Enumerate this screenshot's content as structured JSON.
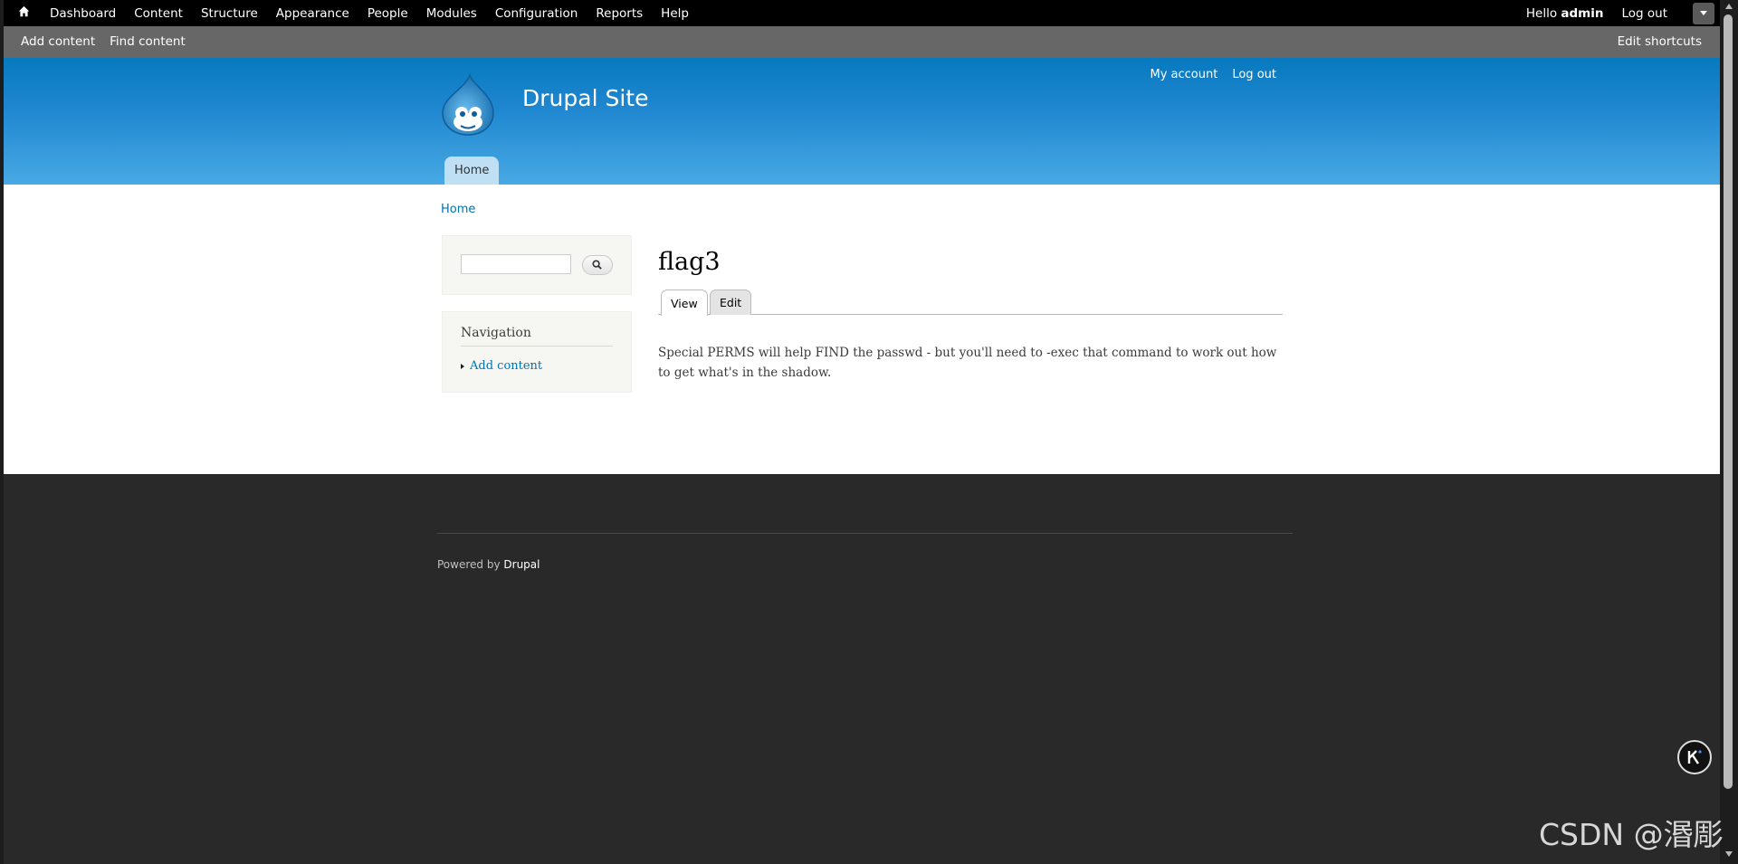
{
  "toolbar": {
    "home_icon": "home-icon",
    "menu": [
      "Dashboard",
      "Content",
      "Structure",
      "Appearance",
      "People",
      "Modules",
      "Configuration",
      "Reports",
      "Help"
    ],
    "hello_prefix": "Hello",
    "username": "admin",
    "logout": "Log out",
    "toggle_icon": "chevron-down-icon"
  },
  "shortcuts": {
    "items": [
      "Add content",
      "Find content"
    ],
    "edit": "Edit shortcuts"
  },
  "header": {
    "site_name": "Drupal Site",
    "secondary_menu": [
      "My account",
      "Log out"
    ],
    "main_menu": [
      "Home"
    ],
    "logo_icon": "drupal-drop-logo"
  },
  "breadcrumb": "Home",
  "sidebar": {
    "search_placeholder": "",
    "search_icon": "search-icon",
    "navigation": {
      "title": "Navigation",
      "items": [
        "Add content"
      ]
    }
  },
  "page": {
    "title": "flag3",
    "tabs": [
      "View",
      "Edit"
    ],
    "active_tab": "View",
    "body": "Special PERMS will help FIND the passwd - but you'll need to -exec that command to work out how to get what's in the shadow."
  },
  "footer": {
    "powered_by": "Powered by",
    "drupal_link": "Drupal"
  },
  "watermark": "CSDN @湣彫",
  "colors": {
    "toolbar": "#000000",
    "shortcuts": "#676767",
    "header_top": "#0779bf",
    "header_bottom": "#48a9e4",
    "link": "#0071b3",
    "footer": "#292929"
  }
}
